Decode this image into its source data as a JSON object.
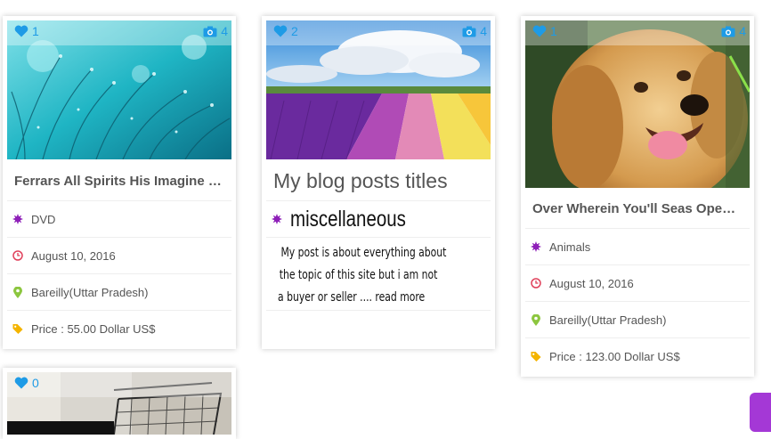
{
  "cards": [
    {
      "likes": "1",
      "photos": "4",
      "title": "Ferrars All Spirits His Imagine E...",
      "category": "DVD",
      "date": "August 10, 2016",
      "location": "Bareilly(Uttar Pradesh)",
      "price": "Price : 55.00 Dollar US$"
    },
    {
      "likes": "2",
      "photos": "4",
      "title": "My blog posts titles",
      "category": "miscellaneous",
      "excerpt_lines": [
        "My post is about everything about",
        "the topic of this site but i am not",
        "a buyer or seller .... read more"
      ]
    },
    {
      "likes": "1",
      "photos": "4",
      "title": "Over Wherein You'll Seas Open ...",
      "category": "Animals",
      "date": "August 10, 2016",
      "location": "Bareilly(Uttar Pradesh)",
      "price": "Price : 123.00 Dollar US$"
    },
    {
      "likes": "0"
    }
  ],
  "colors": {
    "accent_blue": "#1e9be6",
    "category_purple": "#8e1fb8",
    "date_red": "#e0405a",
    "location_green": "#8cc63f",
    "price_yellow": "#f4b400"
  },
  "icons": [
    "heart-icon",
    "camera-icon",
    "category-star-icon",
    "clock-icon",
    "map-pin-icon",
    "tag-icon"
  ]
}
